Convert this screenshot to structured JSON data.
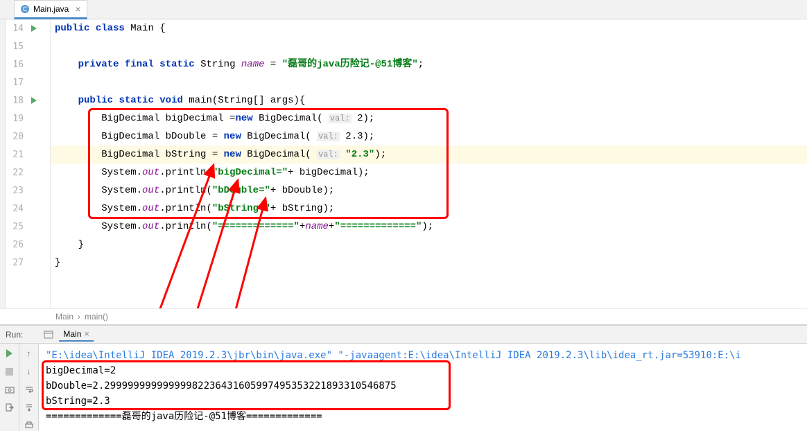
{
  "tab": {
    "name": "Main.java",
    "close": "×"
  },
  "gutter": {
    "lines": [
      14,
      15,
      16,
      17,
      18,
      19,
      20,
      21,
      22,
      23,
      24,
      25,
      26,
      27
    ],
    "run_markers": [
      14,
      18
    ]
  },
  "code": {
    "l14": {
      "public": "public",
      "class": "class",
      "name": " Main {"
    },
    "l16": {
      "private": "private",
      "final": "final",
      "static": "static",
      "type": " String ",
      "field": "name",
      "eq": " = ",
      "str": "\"磊哥的java历险记-@51博客\"",
      "end": ";"
    },
    "l18": {
      "public": "public",
      "static": "static",
      "void": "void",
      "sig": " main(String[] args){"
    },
    "l19": {
      "pre": "BigDecimal bigDecimal =",
      "new": "new",
      "mid": " BigDecimal( ",
      "hint": "val:",
      "arg": " 2",
      "end": ");"
    },
    "l20": {
      "pre": "BigDecimal bDouble = ",
      "new": "new",
      "mid": " BigDecimal( ",
      "hint": "val:",
      "arg": " 2.3",
      "end": ");"
    },
    "l21": {
      "pre": "BigDecimal bString = ",
      "new": "new",
      "mid": " BigDecimal( ",
      "hint": "val:",
      "arg": " \"2.3\"",
      "end": ");"
    },
    "l22": {
      "pre": "System.",
      "out": "out",
      "mid": ".println(",
      "str": "\"bigDecimal=\"",
      "post": "+ bigDecimal);"
    },
    "l23": {
      "pre": "System.",
      "out": "out",
      "mid": ".println(",
      "str": "\"bDouble=\"",
      "post": "+ bDouble);"
    },
    "l24": {
      "pre": "System.",
      "out": "out",
      "mid": ".println(",
      "str": "\"bString=\"",
      "post": "+ bString);"
    },
    "l25": {
      "pre": "System.",
      "out": "out",
      "mid": ".println(",
      "str1": "\"=============\"",
      "plus1": "+",
      "name": "name",
      "plus2": "+",
      "str2": "\"=============\"",
      "end": ");"
    },
    "l26": "    }",
    "l27": "}"
  },
  "breadcrumb": {
    "a": "Main",
    "sep": "›",
    "b": "main()"
  },
  "run": {
    "label": "Run:",
    "tab_name": "Main",
    "tab_close": "×"
  },
  "console": {
    "cmd": "\"E:\\idea\\IntelliJ IDEA 2019.2.3\\jbr\\bin\\java.exe\" \"-javaagent:E:\\idea\\IntelliJ IDEA 2019.2.3\\lib\\idea_rt.jar=53910:E:\\i",
    "out1": "bigDecimal=2",
    "out2": "bDouble=2.29999999999999982236431605997495353221893310546875",
    "out3": "bString=2.3",
    "out4": "=============磊哥的java历险记-@51博客============="
  }
}
